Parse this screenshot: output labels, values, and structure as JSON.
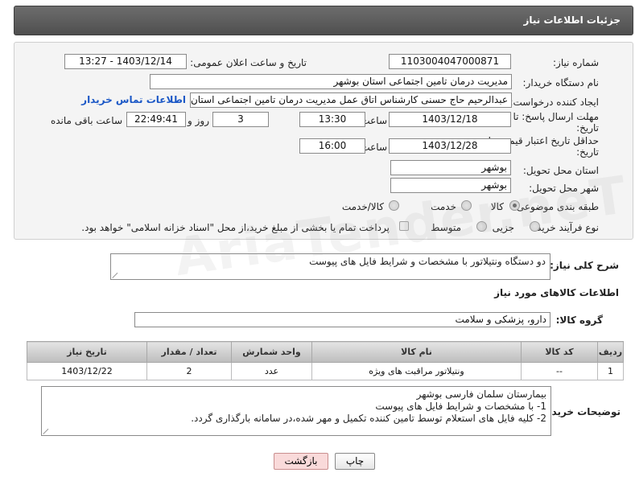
{
  "header": {
    "title": "جزئیات اطلاعات نیاز"
  },
  "form": {
    "need_number": {
      "label": "شماره نیاز:",
      "value": "1103004047000871"
    },
    "announce": {
      "label": "تاریخ و ساعت اعلان عمومی:",
      "value": "1403/12/14 - 13:27"
    },
    "buyer": {
      "label": "نام دستگاه خریدار:",
      "value": "مدیریت درمان تامین اجتماعی استان بوشهر"
    },
    "creator": {
      "label": "ایجاد کننده درخواست:",
      "value": "عبدالرحیم حاج حسنی کارشناس اتاق عمل مدیریت درمان تامین اجتماعی استان بوشهر",
      "contact_link": "اطلاعات تماس خریدار"
    },
    "reply_deadline": {
      "label_line1": "مهلت ارسال پاسخ: تا",
      "label_line2": "تاریخ:",
      "date": "1403/12/18",
      "time_label": "ساعت",
      "time": "13:30",
      "days": "3",
      "days_label": "روز و",
      "remaining": "22:49:41",
      "remaining_label": "ساعت باقی مانده"
    },
    "price_validity": {
      "label_line1": "حداقل تاریخ اعتبار قیمت: تا",
      "label_line2": "تاریخ:",
      "date": "1403/12/28",
      "time_label": "ساعت",
      "time": "16:00"
    },
    "province": {
      "label": "استان محل تحویل:",
      "value": "بوشهر"
    },
    "city": {
      "label": "شهر محل تحویل:",
      "value": "بوشهر"
    },
    "category": {
      "label": "طبقه بندی موضوعی:",
      "options": [
        "کالا",
        "خدمت",
        "کالا/خدمت"
      ],
      "selected": "کالا"
    },
    "process": {
      "label": "نوع فرآیند خرید :",
      "options": [
        "جزیی",
        "متوسط"
      ],
      "note": "پرداخت تمام یا بخشی از مبلغ خرید،از محل \"اسناد خزانه اسلامی\" خواهد بود."
    }
  },
  "description": {
    "label": "شرح کلی نیاز:",
    "value": "دو دستگاه ونتیلاتور با مشخصات و شرایط فایل های پیوست"
  },
  "goods_section": {
    "title": "اطلاعات کالاهای مورد نیاز"
  },
  "goods_group": {
    "label": "گروه کالا:",
    "value": "دارو، پزشکی و سلامت"
  },
  "table": {
    "headers": [
      "ردیف",
      "کد کالا",
      "نام کالا",
      "واحد شمارش",
      "تعداد / مقدار",
      "تاریخ نیاز"
    ],
    "rows": [
      [
        "1",
        "--",
        "ونتیلاتور مراقبت های ویژه",
        "عدد",
        "2",
        "1403/12/22"
      ]
    ]
  },
  "buyer_notes": {
    "label": "توضیحات خریدار:",
    "lines": [
      "بیمارستان سلمان فارسی بوشهر",
      "1- با مشخصات و شرایط فایل های پیوست",
      "2- کلیه فایل های استعلام توسط تامین کننده تکمیل و مهر شده،در سامانه بارگذاری گردد."
    ]
  },
  "buttons": {
    "print": "چاپ",
    "back": "بازگشت"
  },
  "watermark": "AriaTender.neT",
  "colors": {
    "header_bg": "#5e5e5e",
    "link": "#1a57c6",
    "back_button_bg": "#f9dada"
  }
}
